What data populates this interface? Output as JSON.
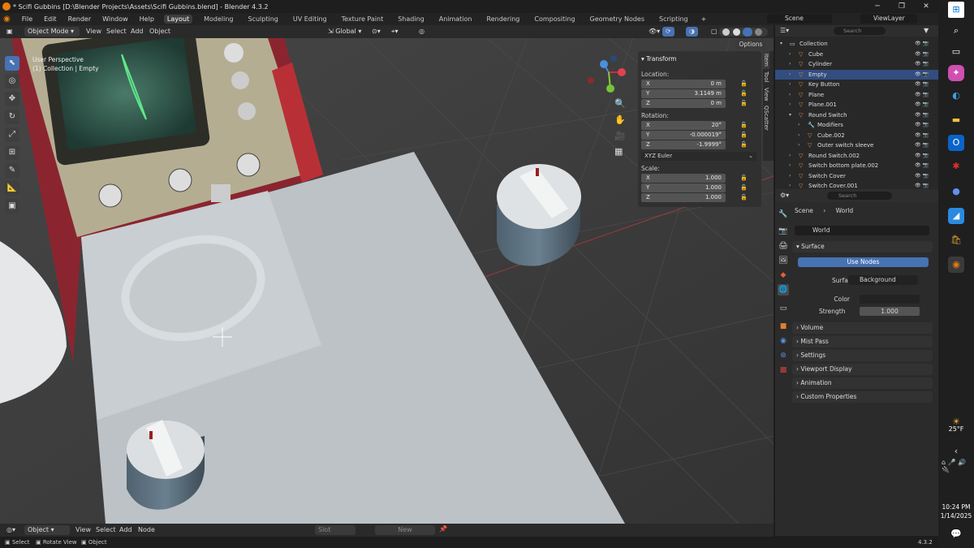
{
  "window": {
    "title": "* Scifi Gubbins [D:\\Blender Projects\\Assets\\Scifi Gubbins.blend] - Blender 4.3.2",
    "min": "─",
    "max": "❐",
    "close": "✕"
  },
  "menu": {
    "items": [
      "File",
      "Edit",
      "Render",
      "Window",
      "Help"
    ],
    "tabs": [
      "Layout",
      "Modeling",
      "Sculpting",
      "UV Editing",
      "Texture Paint",
      "Shading",
      "Animation",
      "Rendering",
      "Compositing",
      "Geometry Nodes",
      "Scripting"
    ],
    "active_tab": "Layout",
    "add_tab": "+",
    "scene_label": "Scene",
    "viewlayer_label": "ViewLayer"
  },
  "viewport_header": {
    "mode": "Object Mode",
    "view": "View",
    "select": "Select",
    "add": "Add",
    "object": "Object",
    "transform_orientation": "Global",
    "options": "Options"
  },
  "viewport": {
    "perspective": "User Perspective",
    "collection_info": "(1) Collection | Empty"
  },
  "npanel": {
    "title": "Transform",
    "location_label": "Location:",
    "loc": [
      {
        "axis": "X",
        "value": "0 m"
      },
      {
        "axis": "Y",
        "value": "3.1149 m"
      },
      {
        "axis": "Z",
        "value": "0 m"
      }
    ],
    "rotation_label": "Rotation:",
    "rot": [
      {
        "axis": "X",
        "value": "20°"
      },
      {
        "axis": "Y",
        "value": "-0.000019°"
      },
      {
        "axis": "Z",
        "value": "-1.9999°"
      }
    ],
    "rotation_mode": "XYZ Euler",
    "scale_label": "Scale:",
    "scale": [
      {
        "axis": "X",
        "value": "1.000"
      },
      {
        "axis": "Y",
        "value": "1.000"
      },
      {
        "axis": "Z",
        "value": "1.000"
      }
    ],
    "tabs": [
      "Item",
      "Tool",
      "View",
      "QScatter"
    ]
  },
  "outliner": {
    "search_placeholder": "Search",
    "rows": [
      {
        "name": "Collection",
        "indent": 0
      },
      {
        "name": "Cube",
        "indent": 1
      },
      {
        "name": "Cylinder",
        "indent": 1
      },
      {
        "name": "Empty",
        "indent": 1,
        "selected": true
      },
      {
        "name": "Key Button",
        "indent": 1
      },
      {
        "name": "Plane",
        "indent": 1
      },
      {
        "name": "Plane.001",
        "indent": 1
      },
      {
        "name": "Round Switch",
        "indent": 1
      },
      {
        "name": "Modifiers",
        "indent": 2
      },
      {
        "name": "Cube.002",
        "indent": 2
      },
      {
        "name": "Outer switch sleeve",
        "indent": 2
      },
      {
        "name": "Round Switch.002",
        "indent": 1
      },
      {
        "name": "Switch bottom plate.002",
        "indent": 1
      },
      {
        "name": "Switch Cover",
        "indent": 1
      },
      {
        "name": "Switch Cover.001",
        "indent": 1
      }
    ]
  },
  "properties": {
    "search_placeholder": "Search",
    "breadcrumb_scene": "Scene",
    "breadcrumb_world": "World",
    "world_name": "World",
    "surface_section": "Surface",
    "use_nodes": "Use Nodes",
    "surface_label": "Surface",
    "surface_value": "Background",
    "color_label": "Color",
    "strength_label": "Strength",
    "strength_value": "1.000",
    "sections": [
      "Volume",
      "Mist Pass",
      "Settings",
      "Viewport Display",
      "Animation",
      "Custom Properties"
    ]
  },
  "bottom_header": {
    "editor": "Object",
    "view": "View",
    "select": "Select",
    "add": "Add",
    "node": "Node",
    "slot": "Slot",
    "new": "New"
  },
  "status": {
    "select": "Select",
    "rotate": "Rotate View",
    "object": "Object",
    "version": "4.3.2"
  },
  "taskbar": {
    "temperature": "25°F",
    "time": "10:24 PM",
    "date": "1/14/2025"
  }
}
